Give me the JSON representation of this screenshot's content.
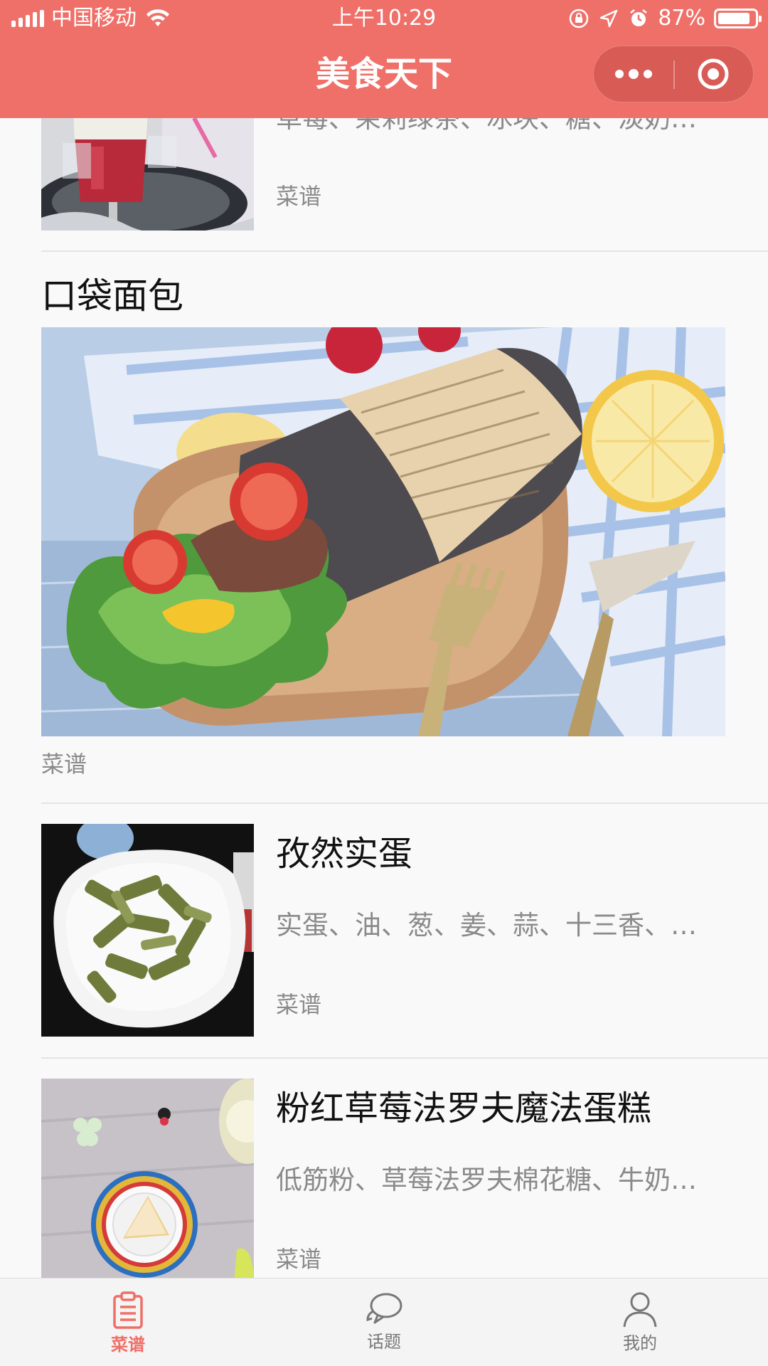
{
  "status_bar": {
    "carrier": "中国移动",
    "time": "上午10:29",
    "battery_percent": "87%",
    "battery_level": 0.87
  },
  "nav": {
    "title": "美食天下",
    "accent_color": "#ef7069"
  },
  "feed": {
    "top_item": {
      "desc": "草莓、茉莉绿茶、冰块、糖、淡奶…",
      "tag": "菜谱"
    },
    "featured": {
      "title": "口袋面包",
      "tag": "菜谱"
    },
    "items": [
      {
        "title": "孜然实蛋",
        "desc": "实蛋、油、葱、姜、蒜、十三香、…",
        "tag": "菜谱"
      },
      {
        "title": "粉红草莓法罗夫魔法蛋糕",
        "desc": "低筋粉、草莓法罗夫棉花糖、牛奶…",
        "tag": "菜谱"
      }
    ]
  },
  "tabbar": {
    "tabs": [
      {
        "label": "菜谱",
        "icon": "clipboard-icon",
        "active": true
      },
      {
        "label": "话题",
        "icon": "chat-bubbles-icon",
        "active": false
      },
      {
        "label": "我的",
        "icon": "user-icon",
        "active": false
      }
    ],
    "active_color": "#ef6f67"
  }
}
